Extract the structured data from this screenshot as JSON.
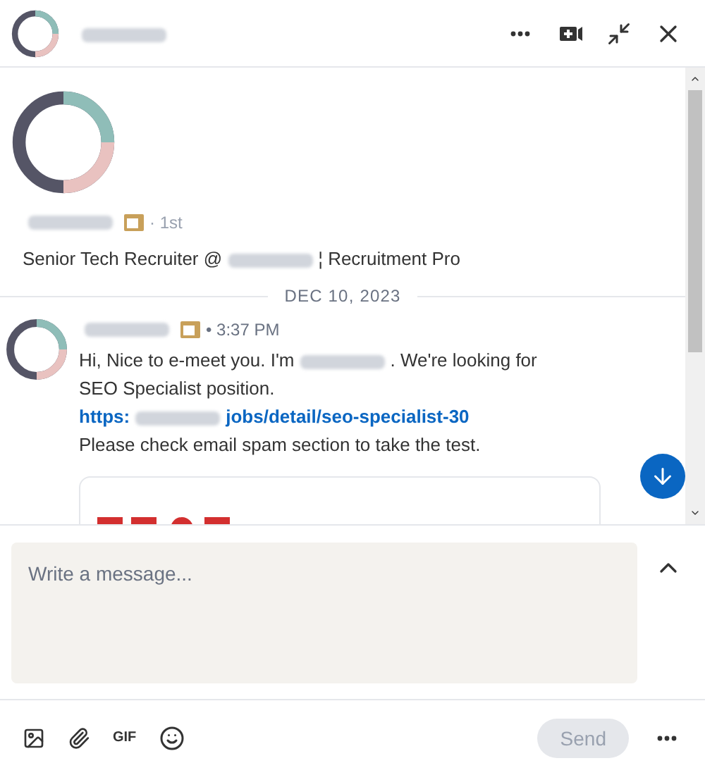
{
  "header": {
    "name": [
      {
        "kind": "redacted"
      }
    ]
  },
  "profile": {
    "name": [
      {
        "kind": "redacted"
      }
    ],
    "degree": "· 1st",
    "headline": [
      {
        "kind": "text",
        "text": "Senior Tech Recruiter @"
      },
      {
        "kind": "redacted"
      },
      {
        "kind": "text",
        "text": "¦ Recruitment Pro"
      }
    ]
  },
  "date_divider": "DEC 10, 2023",
  "message": {
    "sender": [
      {
        "kind": "redacted"
      }
    ],
    "time": "• 3:37 PM",
    "body": [
      {
        "kind": "text",
        "text": "Hi, Nice to e-meet you. I'm"
      },
      {
        "kind": "redacted"
      },
      {
        "kind": "text",
        "text": ". We're looking for SEO Specialist position."
      }
    ],
    "link": [
      {
        "kind": "text",
        "text": "https:"
      },
      {
        "kind": "redacted"
      },
      {
        "kind": "text",
        "text": "jobs/detail/seo-specialist-30"
      }
    ],
    "footer": "Please check email spam section to take the test."
  },
  "composer": {
    "placeholder": "Write a message..."
  },
  "toolbar": {
    "gif": "GIF",
    "send": "Send",
    "send_disabled": true
  }
}
